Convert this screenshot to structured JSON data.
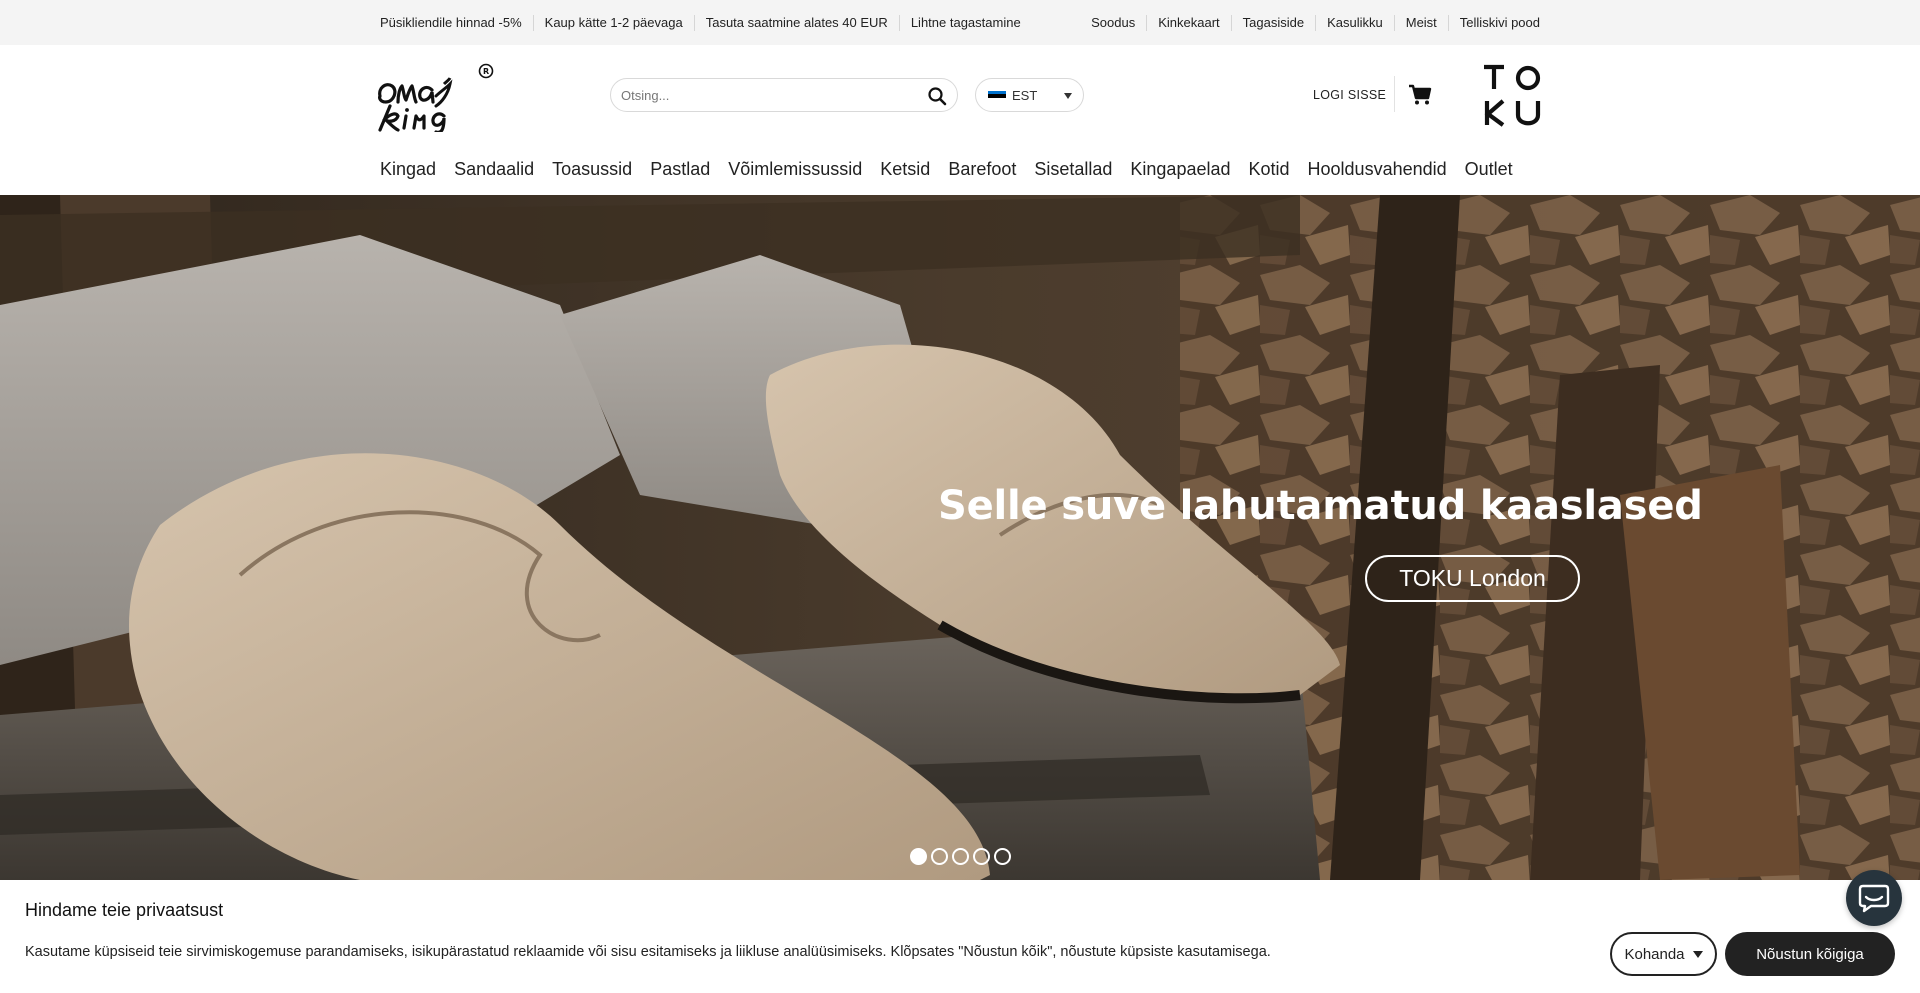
{
  "topbar": {
    "left": [
      "Püsikliendile hinnad -5%",
      "Kaup kätte 1-2 päevaga",
      "Tasuta saatmine alates 40 EUR",
      "Lihtne tagastamine"
    ],
    "right": [
      "Soodus",
      "Kinkekaart",
      "Tagasiside",
      "Kasulikku",
      "Meist",
      "Telliskivi pood"
    ]
  },
  "header": {
    "logo_text": "oma king",
    "search_placeholder": "Otsing...",
    "language": "EST",
    "login": "LOGI SISSE",
    "brand_logo_text": "TOKU"
  },
  "nav": [
    "Kingad",
    "Sandaalid",
    "Toasussid",
    "Pastlad",
    "Võimlemissussid",
    "Ketsid",
    "Barefoot",
    "Sisetallad",
    "Kingapaelad",
    "Kotid",
    "Hooldusvahendid",
    "Outlet"
  ],
  "hero": {
    "title": "Selle suve lahutamatud kaaslased",
    "cta": "TOKU London",
    "slide_count": 5,
    "active_slide": 1
  },
  "cookie": {
    "title": "Hindame teie privaatsust",
    "text": "Kasutame küpsiseid teie sirvimiskogemuse parandamiseks, isikupärastatud reklaamide või sisu esitamiseks ja liikluse analüüsimiseks. Klõpsates \"Nõustun kõik\", nõustute küpsiste kasutamisega.",
    "customize": "Kohanda",
    "accept": "Nõustun kõigiga"
  },
  "colors": {
    "topbar_bg": "#f4f4f4",
    "dark_button": "#222222",
    "chat_bg": "#27343d",
    "flag_blue": "#0072ce",
    "flag_black": "#000000",
    "flag_white": "#ffffff"
  },
  "icons": {
    "search": "search-icon",
    "cart": "cart-icon",
    "chat": "chat-icon",
    "caret": "caret-down-icon"
  }
}
